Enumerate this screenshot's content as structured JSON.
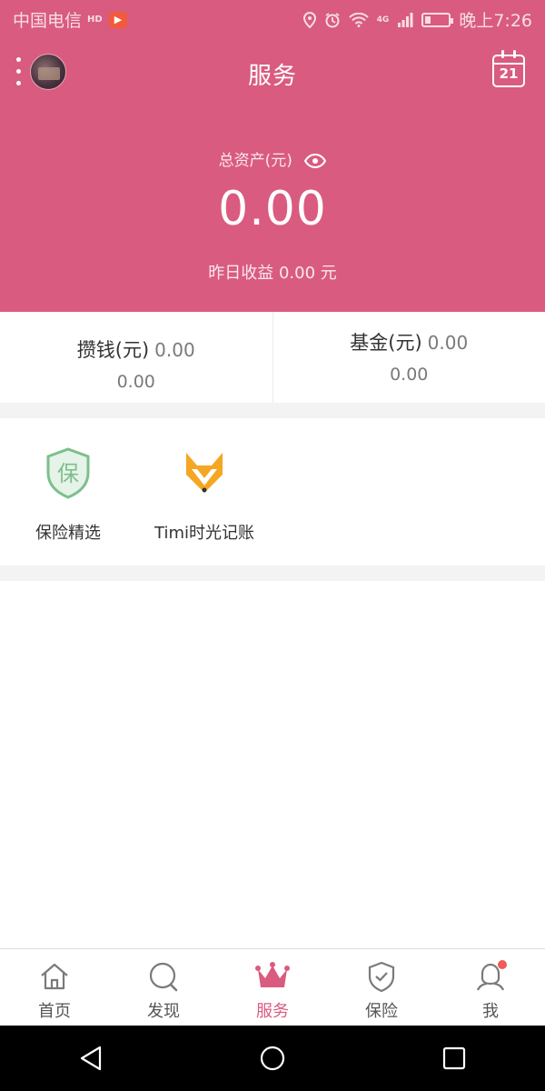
{
  "status_bar": {
    "carrier": "中国电信",
    "hd_badge": "HD",
    "network": "4G",
    "time": "晚上7:26",
    "battery_level": 0.25
  },
  "header": {
    "title": "服务",
    "calendar_day": "21",
    "asset_label": "总资产(元)",
    "asset_total": "0.00",
    "yesterday_earnings": "昨日收益 0.00 元"
  },
  "balances": [
    {
      "name": "攒钱(元)",
      "value": "0.00",
      "sub_value": "0.00"
    },
    {
      "name": "基金(元)",
      "value": "0.00",
      "sub_value": "0.00"
    }
  ],
  "services": [
    {
      "label": "保险精选",
      "icon": "insurance-shield-icon",
      "color": "#7dbf8c"
    },
    {
      "label": "Timi时光记账",
      "icon": "fox-icon",
      "color": "#f5a623"
    }
  ],
  "bottom_nav": [
    {
      "label": "首页",
      "icon": "home-icon",
      "active": false
    },
    {
      "label": "发现",
      "icon": "search-icon",
      "active": false
    },
    {
      "label": "服务",
      "icon": "crown-icon",
      "active": true
    },
    {
      "label": "保险",
      "icon": "shield-check-icon",
      "active": false
    },
    {
      "label": "我",
      "icon": "person-icon",
      "active": false,
      "has_badge": true
    }
  ],
  "colors": {
    "brand": "#d95b80",
    "badge": "#f05a5a"
  }
}
